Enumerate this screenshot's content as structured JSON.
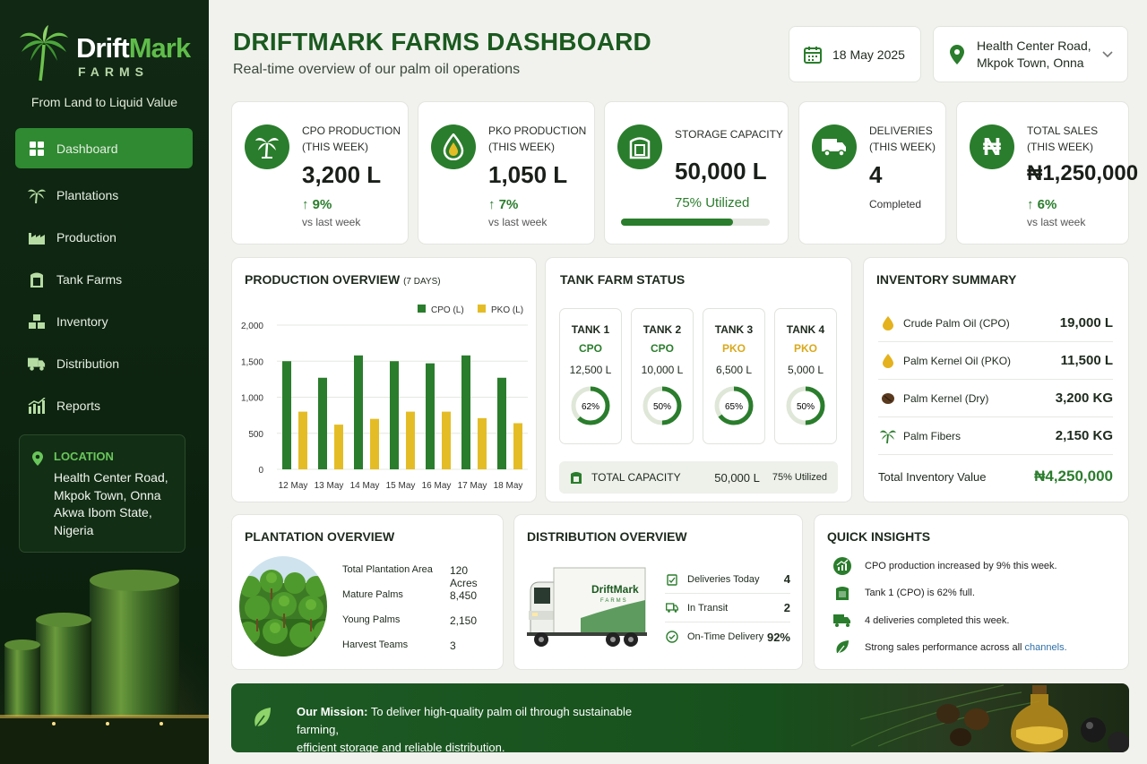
{
  "brand": {
    "name_a": "Drift",
    "name_b": "Mark",
    "sub": "FARMS",
    "tagline": "From Land to Liquid Value"
  },
  "nav": [
    {
      "label": "Dashboard",
      "icon": "grid-icon"
    },
    {
      "label": "Plantations",
      "icon": "palm-icon"
    },
    {
      "label": "Production",
      "icon": "factory-icon"
    },
    {
      "label": "Tank Farms",
      "icon": "tank-icon"
    },
    {
      "label": "Inventory",
      "icon": "boxes-icon"
    },
    {
      "label": "Distribution",
      "icon": "truck-icon"
    },
    {
      "label": "Reports",
      "icon": "bar-chart-icon"
    }
  ],
  "location": {
    "title": "LOCATION",
    "lines": [
      "Health Center Road,",
      "Mkpok Town, Onna",
      "Akwa Ibom State,",
      "Nigeria"
    ]
  },
  "header": {
    "title": "DRIFTMARK FARMS DASHBOARD",
    "subtitle": "Real-time overview of our palm oil operations",
    "date": "18 May 2025",
    "location_l1": "Health Center Road,",
    "location_l2": "Mkpok Town, Onna"
  },
  "kpis": [
    {
      "label_l1": "CPO PRODUCTION",
      "label_l2": "(THIS WEEK)",
      "value": "3,200 L",
      "delta": "9%",
      "vs": "vs last week"
    },
    {
      "label_l1": "PKO PRODUCTION",
      "label_l2": "(THIS WEEK)",
      "value": "1,050 L",
      "delta": "7%",
      "vs": "vs last week"
    },
    {
      "label_l1": "STORAGE CAPACITY",
      "value": "50,000 L",
      "util": "75% Utilized",
      "util_fraction": 0.75
    },
    {
      "label_l1": "DELIVERIES",
      "label_l2": "(THIS WEEK)",
      "value": "4",
      "note": "Completed"
    },
    {
      "label_l1": "TOTAL SALES",
      "label_l2": "(THIS WEEK)",
      "value": "₦1,250,000",
      "delta": "6%",
      "vs": "vs last week"
    }
  ],
  "production": {
    "title": "PRODUCTION OVERVIEW",
    "title_small": "(7 DAYS)"
  },
  "chart_data": {
    "type": "bar",
    "categories": [
      "12 May",
      "13 May",
      "14 May",
      "15 May",
      "16 May",
      "17 May",
      "18 May"
    ],
    "series": [
      {
        "name": "CPO (L)",
        "color": "#2a7d2c",
        "values": [
          1500,
          1270,
          1580,
          1500,
          1470,
          1580,
          1270
        ]
      },
      {
        "name": "PKO (L)",
        "color": "#e4bd26",
        "values": [
          800,
          620,
          700,
          800,
          800,
          710,
          640
        ]
      }
    ],
    "yticks": [
      "2,000",
      "1,500",
      "1,000",
      "500",
      "0"
    ],
    "ylim": [
      0,
      2000
    ],
    "grid": true,
    "legend": "top-right"
  },
  "tanks": {
    "title": "TANK FARM STATUS",
    "items": [
      {
        "name": "TANK 1",
        "type": "CPO",
        "volume": "12,500 L",
        "pct_label": "62%",
        "pct": 0.62
      },
      {
        "name": "TANK 2",
        "type": "CPO",
        "volume": "10,000 L",
        "pct_label": "50%",
        "pct": 0.5
      },
      {
        "name": "TANK 3",
        "type": "PKO",
        "volume": "6,500 L",
        "pct_label": "65%",
        "pct": 0.65
      },
      {
        "name": "TANK 4",
        "type": "PKO",
        "volume": "5,000 L",
        "pct_label": "50%",
        "pct": 0.5
      }
    ],
    "total_label": "TOTAL CAPACITY",
    "total_value": "50,000 L",
    "total_util": "75% Utilized"
  },
  "inventory": {
    "title": "INVENTORY SUMMARY",
    "items": [
      {
        "name": "Crude Palm Oil (CPO)",
        "value": "19,000 L"
      },
      {
        "name": "Palm Kernel Oil (PKO)",
        "value": "11,500 L"
      },
      {
        "name": "Palm Kernel (Dry)",
        "value": "3,200 KG"
      },
      {
        "name": "Palm Fibers",
        "value": "2,150 KG"
      }
    ],
    "total_label": "Total Inventory Value",
    "total_value": "₦4,250,000"
  },
  "plantation": {
    "title": "PLANTATION OVERVIEW",
    "rows": [
      {
        "label": "Total Plantation Area",
        "value": "120 Acres"
      },
      {
        "label": "Mature Palms",
        "value": "8,450"
      },
      {
        "label": "Young Palms",
        "value": "2,150"
      },
      {
        "label": "Harvest Teams",
        "value": "3"
      }
    ]
  },
  "distribution": {
    "title": "DISTRIBUTION OVERVIEW",
    "truck_brand": "DriftMark",
    "truck_sub": "FARMS",
    "rows": [
      {
        "label": "Deliveries Today",
        "value": "4"
      },
      {
        "label": "In Transit",
        "value": "2"
      },
      {
        "label": "On-Time Delivery",
        "value": "92%"
      }
    ]
  },
  "insights": {
    "title": "QUICK INSIGHTS",
    "items": [
      "CPO production increased by 9% this week.",
      "Tank 1 (CPO) is 62% full.",
      "4 deliveries completed this week.",
      "Strong sales performance across all "
    ],
    "link": "channels."
  },
  "mission": {
    "label": "Our Mission:",
    "text_l1": "To deliver high-quality palm oil through sustainable farming,",
    "text_l2": "efficient storage and reliable distribution."
  }
}
